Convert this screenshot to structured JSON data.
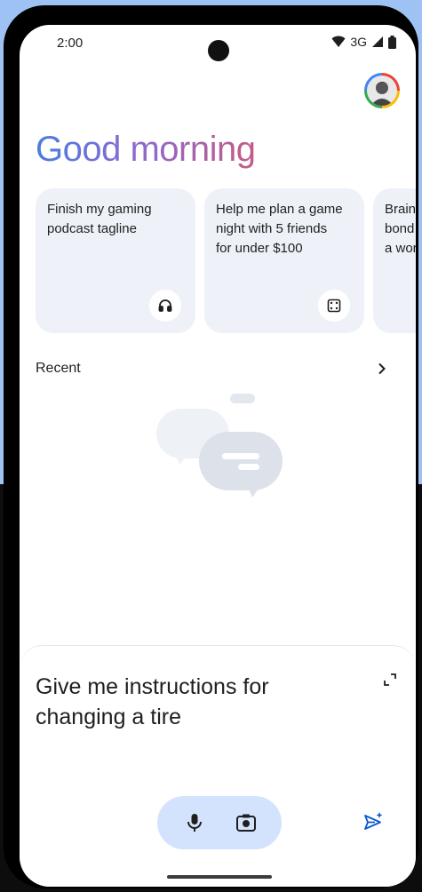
{
  "status_bar": {
    "time": "2:00",
    "network": "3G"
  },
  "greeting": "Good morning",
  "suggestions": [
    {
      "text": "Finish my gaming\npodcast tagline",
      "icon": "headphones-icon"
    },
    {
      "text": "Help me plan a game\nnight with 5 friends\nfor under $100",
      "icon": "dice-icon"
    },
    {
      "text": "Brains\nbond\na wor",
      "icon": ""
    }
  ],
  "recent": {
    "label": "Recent"
  },
  "prompt": {
    "text": "Give me instructions for changing a tire"
  },
  "colors": {
    "accent": "#0b57d0",
    "pill_background": "#d3e3fd",
    "card_background": "#eef2f8"
  }
}
